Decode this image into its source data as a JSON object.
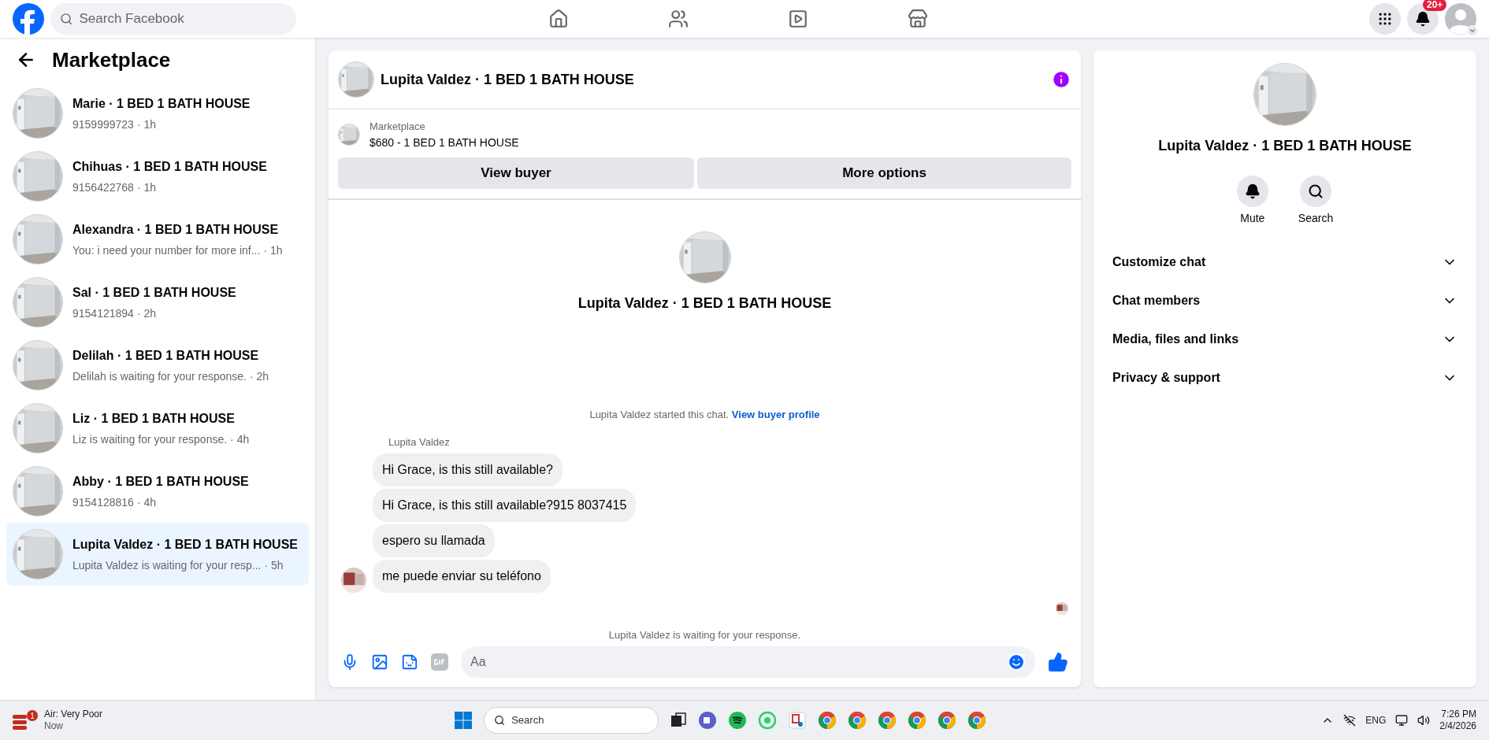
{
  "topbar": {
    "search_placeholder": "Search Facebook",
    "nav": [
      {
        "kind": "home",
        "selected": false
      },
      {
        "kind": "friends",
        "selected": false
      },
      {
        "kind": "video",
        "selected": false
      },
      {
        "kind": "marketplace",
        "selected": false
      }
    ],
    "notification_badge": "20+"
  },
  "sidebar": {
    "title": "Marketplace",
    "items": [
      {
        "title": "Marie · 1 BED 1 BATH HOUSE",
        "preview": "9159999723",
        "time": "· 1h",
        "selected": false
      },
      {
        "title": "Chihuas · 1 BED 1 BATH HOUSE",
        "preview": "9156422768",
        "time": "· 1h",
        "selected": false
      },
      {
        "title": "Alexandra · 1 BED 1 BATH HOUSE",
        "preview": "You: i need your number for more inf...",
        "time": "· 1h",
        "selected": false
      },
      {
        "title": "Sal · 1 BED 1 BATH HOUSE",
        "preview": "9154121894",
        "time": "· 2h",
        "selected": false
      },
      {
        "title": "Delilah · 1 BED 1 BATH HOUSE",
        "preview": "Delilah is waiting for your response.",
        "time": "· 2h",
        "selected": false
      },
      {
        "title": "Liz · 1 BED 1 BATH HOUSE",
        "preview": "Liz is waiting for your response.",
        "time": "· 4h",
        "selected": false
      },
      {
        "title": "Abby · 1 BED 1 BATH HOUSE",
        "preview": "9154128816",
        "time": "· 4h",
        "selected": false
      },
      {
        "title": "Lupita Valdez · 1 BED 1 BATH HOUSE",
        "preview": "Lupita Valdez is waiting for your resp...",
        "time": "· 5h",
        "selected": true
      }
    ]
  },
  "chat": {
    "title": "Lupita Valdez · 1 BED 1 BATH HOUSE",
    "listing": {
      "source": "Marketplace",
      "name": "$680 - 1 BED 1 BATH HOUSE"
    },
    "buttons": [
      "View buyer",
      "More options"
    ],
    "intro_title": "Lupita Valdez · 1 BED 1 BATH HOUSE",
    "started": "Lupita Valdez started this chat.",
    "profile_link": "View buyer profile",
    "sender": "Lupita Valdez",
    "messages": [
      "Hi Grace, is this still available?",
      "Hi Grace, is this still available?915 8037415",
      "espero su llamada",
      "me puede enviar su teléfono"
    ],
    "waiting": "Lupita Valdez is waiting for your response.",
    "composer_placeholder": "Aa"
  },
  "details": {
    "title": "Lupita Valdez · 1 BED 1 BATH HOUSE",
    "actions": [
      {
        "kind": "mute",
        "label": "Mute"
      },
      {
        "kind": "search",
        "label": "Search"
      }
    ],
    "sections": [
      {
        "label": "Customize chat",
        "expanded": false
      },
      {
        "label": "Chat members",
        "expanded": false
      },
      {
        "label": "Media, files and links",
        "expanded": false
      },
      {
        "label": "Privacy & support",
        "expanded": false
      }
    ]
  },
  "taskbar": {
    "weather_badge": "1",
    "weather_title": "Air: Very Poor",
    "weather_sub": "Now",
    "search_placeholder": "Search",
    "language": "ENG",
    "time": "7:26 PM",
    "date": "2/4/2026"
  }
}
